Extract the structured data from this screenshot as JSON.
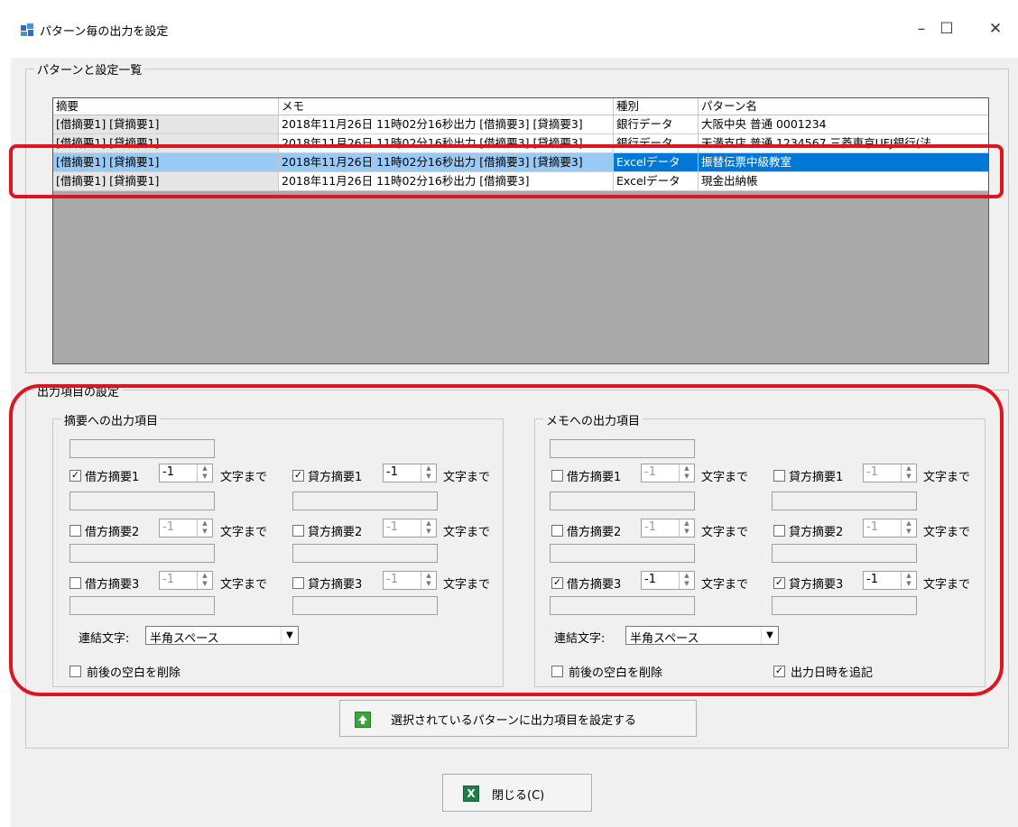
{
  "window": {
    "title": "パターン毎の出力を設定",
    "minimize_glyph": "–",
    "maximize_glyph": "☐",
    "close_glyph": "✕"
  },
  "patterns_group": {
    "label": "パターンと設定一覧",
    "columns": [
      "摘要",
      "メモ",
      "種別",
      "パターン名"
    ],
    "rows": [
      {
        "summary": "[借摘要1] [貸摘要1]",
        "memo": "2018年11月26日 11時02分16秒出力 [借摘要3] [貸摘要3]",
        "type": "銀行データ",
        "name": "大阪中央 普通 0001234"
      },
      {
        "summary": "[借摘要1] [貸摘要1]",
        "memo": "2018年11月26日 11時02分16秒出力 [借摘要3] [貸摘要3]",
        "type": "銀行データ",
        "name": "天満支店 普通 1234567 三菱東京UFJ銀行(法..."
      },
      {
        "summary": "[借摘要1] [貸摘要1]",
        "memo": "2018年11月26日 11時02分16秒出力 [借摘要3] [貸摘要3]",
        "type": "Excelデータ",
        "name": "振替伝票中級教室"
      },
      {
        "summary": "[借摘要1] [貸摘要1]",
        "memo": "2018年11月26日 11時02分16秒出力 [借摘要3]",
        "type": "Excelデータ",
        "name": "現金出納帳"
      }
    ]
  },
  "output_group": {
    "label": "出力項目の設定",
    "summary_panel": {
      "label": "摘要への出力項目",
      "debit1": "借方摘要1",
      "credit1": "貸方摘要1",
      "debit2": "借方摘要2",
      "credit2": "貸方摘要2",
      "debit3": "借方摘要3",
      "credit3": "貸方摘要3",
      "debit1_checked": true,
      "credit1_checked": true,
      "spin_value": "-1",
      "suffix": "文字まで",
      "join_label": "連結文字:",
      "join_value": "半角スペース",
      "trim_label": "前後の空白を削除"
    },
    "memo_panel": {
      "label": "メモへの出力項目",
      "debit1": "借方摘要1",
      "credit1": "貸方摘要1",
      "debit2": "借方摘要2",
      "credit2": "貸方摘要2",
      "debit3": "借方摘要3",
      "credit3": "貸方摘要3",
      "debit3_checked": true,
      "credit3_checked": true,
      "spin_value": "-1",
      "suffix": "文字まで",
      "join_label": "連結文字:",
      "join_value": "半角スペース",
      "trim_label": "前後の空白を削除",
      "append_datetime_label": "出力日時を追記"
    }
  },
  "apply_button": {
    "label": "選択されているパターンに出力項目を設定する",
    "icon": "green-up-arrow-icon"
  },
  "close_button": {
    "label": "閉じる(C)",
    "icon": "excel-icon"
  },
  "colors": {
    "selection": "#0078d7",
    "selection_light": "#99c9f5",
    "annotation_red": "#e0141e",
    "green": "#3aa53a"
  }
}
